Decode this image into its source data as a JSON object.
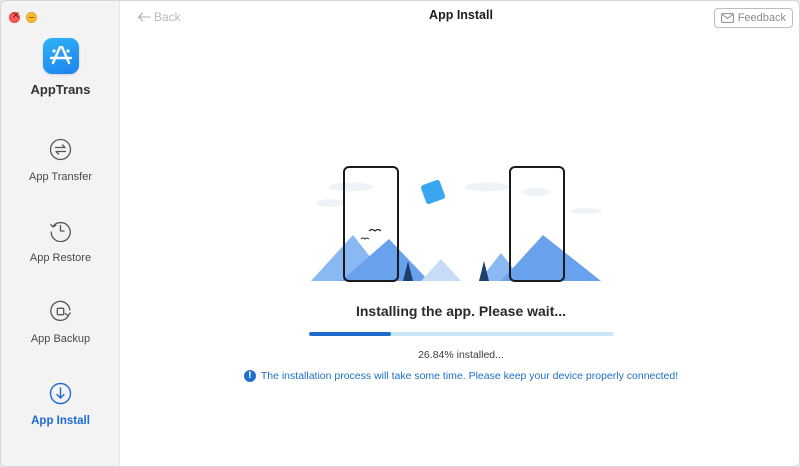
{
  "window": {
    "title": "App Install"
  },
  "sidebar": {
    "brand": "AppTrans",
    "items": [
      {
        "label": "App Transfer",
        "icon": "transfer-arrows-icon",
        "active": false
      },
      {
        "label": "App Restore",
        "icon": "restore-clock-icon",
        "active": false
      },
      {
        "label": "App Backup",
        "icon": "backup-icon",
        "active": false
      },
      {
        "label": "App Install",
        "icon": "install-download-icon",
        "active": true
      }
    ]
  },
  "header": {
    "back_label": "Back",
    "feedback_label": "Feedback"
  },
  "main": {
    "status": "Installing the app. Please wait...",
    "progress": 0.2684,
    "percent_text": "26.84% installed...",
    "notice": "The installation process will take some time. Please keep your device properly connected!",
    "info_glyph": "!"
  },
  "colors": {
    "accent": "#1b6bd2",
    "progress_fill": "#1d6ccc",
    "progress_track": "#cbe6f6",
    "close": "#fd5c58",
    "minimize": "#fdbc2e"
  }
}
